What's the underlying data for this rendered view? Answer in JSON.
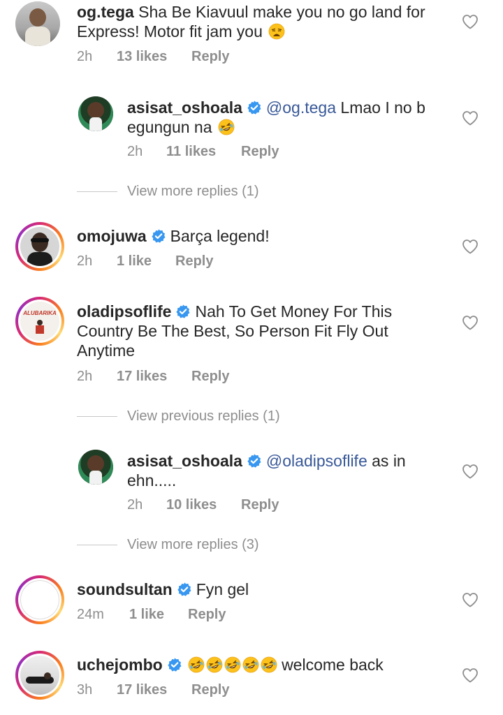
{
  "colors": {
    "text": "#262626",
    "meta": "#8e8e8e",
    "mention": "#385898",
    "verified": "#3897f0"
  },
  "icons": {
    "like": "heart-outline-icon",
    "verified": "verified-badge-icon"
  },
  "comments": [
    {
      "username": "og.tega",
      "text": "Sha Be Kiavuul make you no go land for Express! Motor fit jam you",
      "emoji": "weary-face",
      "time": "2h",
      "likes": "13 likes",
      "reply": "Reply"
    },
    {
      "username": "asisat_oshoala",
      "mention": "@og.tega",
      "text": "Lmao I no b egungun na",
      "emoji": "rolling-on-floor-laughing",
      "time": "2h",
      "likes": "11 likes",
      "reply": "Reply"
    },
    {
      "view_more": "View more replies (1)"
    },
    {
      "username": "omojuwa",
      "text": "Barça legend!",
      "time": "2h",
      "likes": "1 like",
      "reply": "Reply"
    },
    {
      "username": "oladipsoflife",
      "avatar_text": "ALUBARIKA",
      "text_line1": "Nah To Get Money For This",
      "text_line2": "Country Be The Best, So Person Fit Fly Out",
      "text_line3": "Anytime",
      "time": "2h",
      "likes": "17 likes",
      "reply": "Reply"
    },
    {
      "view_previous": "View previous replies (1)"
    },
    {
      "username": "asisat_oshoala",
      "mention": "@oladipsoflife",
      "text": "as in ehn.....",
      "time": "2h",
      "likes": "10 likes",
      "reply": "Reply"
    },
    {
      "view_more": "View more replies (3)"
    },
    {
      "username": "soundsultan",
      "text": "Fyn gel",
      "time": "24m",
      "likes": "1 like",
      "reply": "Reply"
    },
    {
      "username": "uchejombo",
      "text": "welcome back",
      "emoji_count": 5,
      "time": "3h",
      "likes": "17 likes",
      "reply": "Reply"
    }
  ]
}
